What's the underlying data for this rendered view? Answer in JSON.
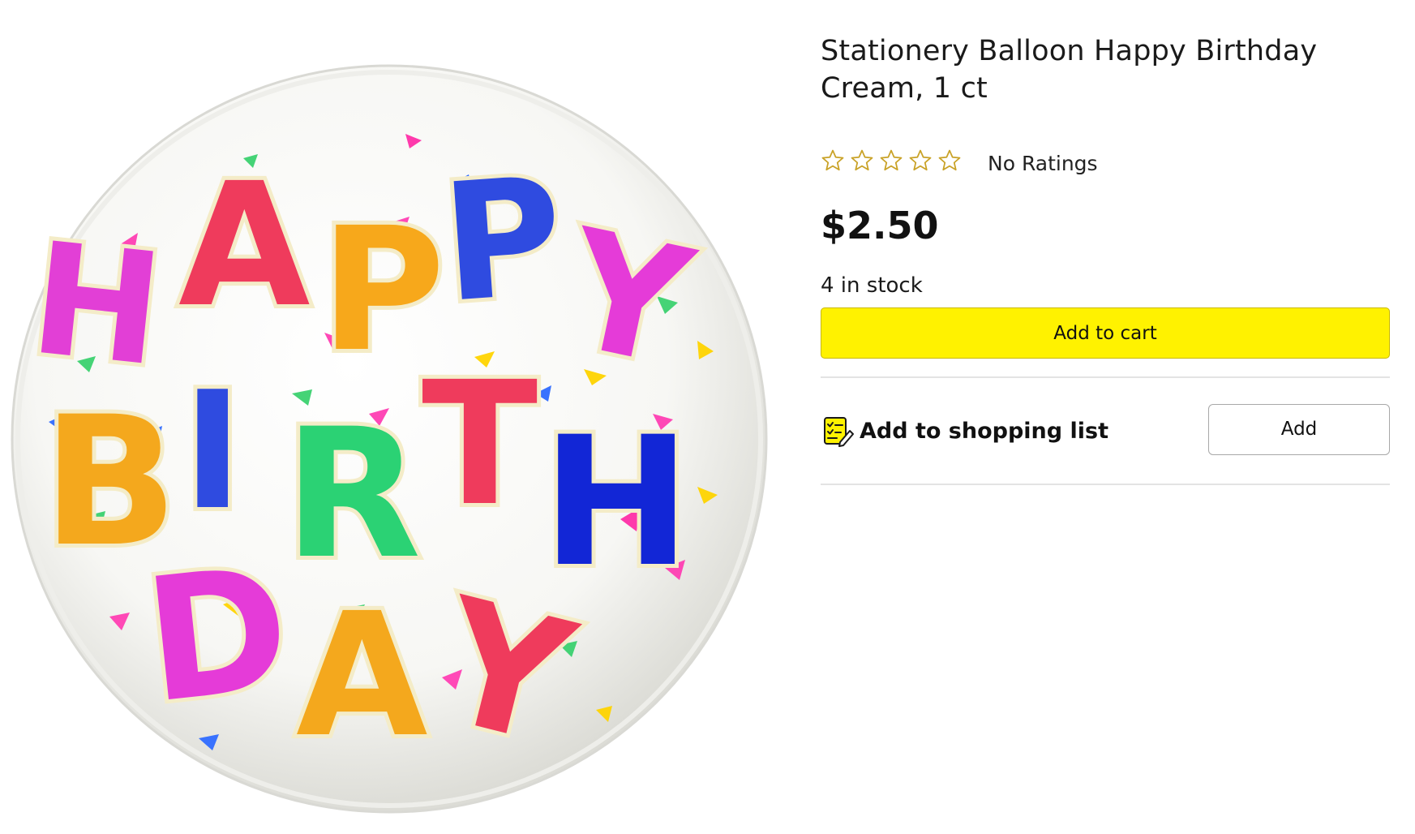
{
  "product": {
    "title": "Stationery Balloon Happy Birthday Cream, 1 ct",
    "rating": {
      "stars_filled": 0,
      "stars_total": 5,
      "star_icon": "star-outline-icon",
      "text": "No Ratings"
    },
    "price": "$2.50",
    "stock": "4 in stock"
  },
  "actions": {
    "add_to_cart_label": "Add to cart",
    "shopping_list_label": "Add to shopping list",
    "shopping_list_icon": "shopping-list-icon",
    "add_label": "Add"
  },
  "image": {
    "letters": [
      "H",
      "A",
      "P",
      "P",
      "Y",
      "B",
      "I",
      "R",
      "T",
      "H",
      "D",
      "A",
      "Y"
    ]
  },
  "colors": {
    "add_to_cart_bg": "#fff200",
    "star_outline": "#c9a227",
    "divider": "#e3e3e3"
  }
}
